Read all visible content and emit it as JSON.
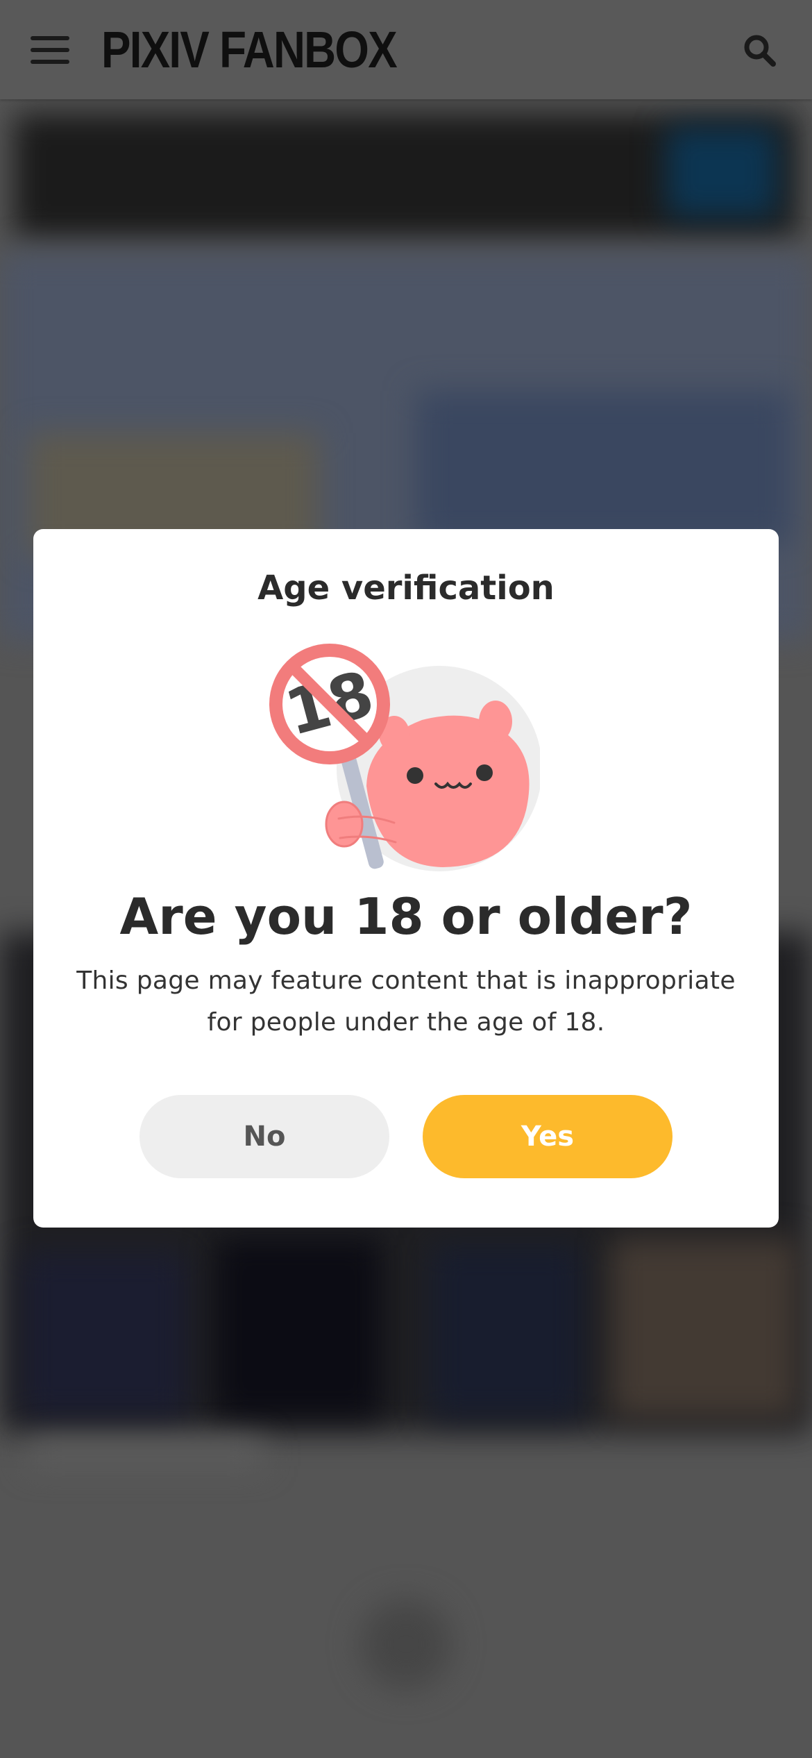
{
  "header": {
    "logo_text": "PIXIV FANBOX",
    "menu_icon": "hamburger-menu-icon",
    "search_icon": "search-icon"
  },
  "modal": {
    "title": "Age verification",
    "illustration": "r18-sign-mascot",
    "question": "Are you 18 or older?",
    "description": "This page may feature content that is inappropriate for people under the age of 18.",
    "no_label": "No",
    "yes_label": "Yes"
  },
  "colors": {
    "overlay": "#555555",
    "yes_button": "#fdba2c",
    "no_button": "#eeeeee",
    "mascot_pink": "#fe9595",
    "sign_red": "#f27c7c"
  }
}
